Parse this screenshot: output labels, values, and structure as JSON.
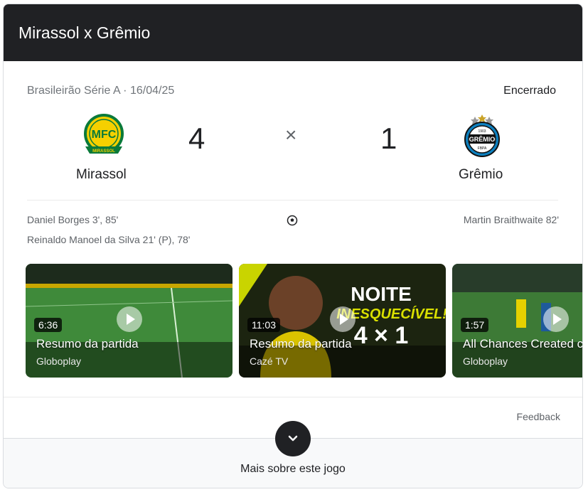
{
  "header": {
    "title": "Mirassol x Grêmio"
  },
  "match": {
    "competition_date": "Brasileirão Série A · 16/04/25",
    "status": "Encerrado",
    "home": {
      "name": "Mirassol",
      "score": "4",
      "logo_text": "MFC",
      "logo_caption": "MIRASSOL",
      "color": "#f5d000"
    },
    "away": {
      "name": "Grêmio",
      "score": "1",
      "logo_text": "GRÊMIO",
      "logo_year": "1903",
      "logo_caption": "FBPA",
      "color": "#0d80bf"
    },
    "separator": "×"
  },
  "scorers": {
    "home": [
      "Daniel Borges 3', 85'",
      "Reinaldo Manoel da Silva 21' (P), 78'"
    ],
    "away": [
      "Martin Braithwaite 82'"
    ]
  },
  "videos": [
    {
      "duration": "6:36",
      "title": "Resumo da partida",
      "source": "Globoplay"
    },
    {
      "duration": "11:03",
      "title": "Resumo da partida",
      "source": "Cazé TV",
      "overlay_line1": "NOITE",
      "overlay_line2": "INESQUECÍVEL!",
      "overlay_score": "4 × 1"
    },
    {
      "duration": "1:57",
      "title": "All Chances Created c",
      "source": "Globoplay"
    }
  ],
  "feedback_label": "Feedback",
  "more_label": "Mais sobre este jogo",
  "colors": {
    "header_bg": "#202124",
    "accent_yellow": "#f5d000",
    "gremio_blue": "#0d80bf"
  }
}
